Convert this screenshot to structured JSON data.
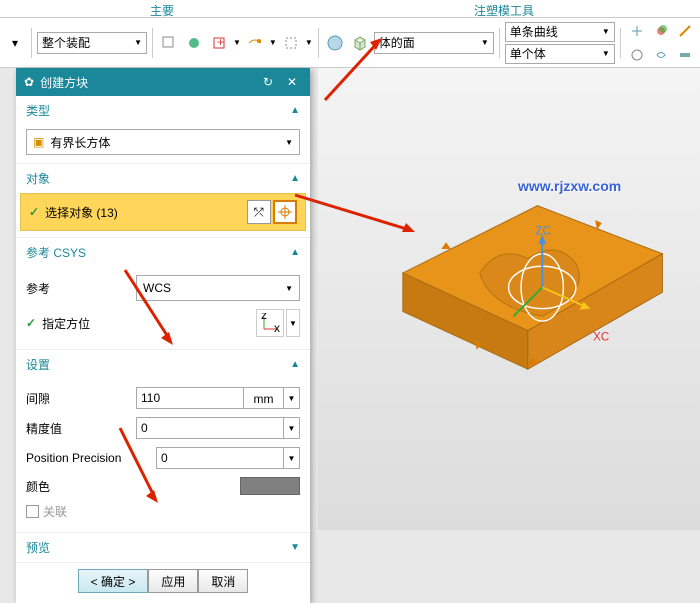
{
  "menu": {
    "main": "主要",
    "moldTool": "注塑模工具"
  },
  "toolbar": {
    "assembly": "整个装配",
    "object": "体的面",
    "curve": "单条曲线",
    "body": "单个体"
  },
  "dialog": {
    "title": "创建方块",
    "type": {
      "label": "类型",
      "value": "有界长方体"
    },
    "object": {
      "label": "对象",
      "selectText": "选择对象 (13)"
    },
    "csys": {
      "label": "参考 CSYS",
      "refLabel": "参考",
      "refValue": "WCS",
      "orientLabel": "指定方位"
    },
    "settings": {
      "label": "设置",
      "gapLabel": "间隙",
      "gapValue": "110",
      "gapUnit": "mm",
      "precLabel": "精度值",
      "precValue": "0",
      "posLabel": "Position Precision",
      "posValue": "0",
      "colorLabel": "颜色",
      "assocLabel": "关联"
    },
    "preview": {
      "label": "预览"
    },
    "buttons": {
      "ok": "< 确定 >",
      "apply": "应用",
      "cancel": "取消"
    }
  },
  "viewport": {
    "watermark": "www.rjzxw.com",
    "axisZC": "ZC",
    "axisXC": "XC"
  }
}
